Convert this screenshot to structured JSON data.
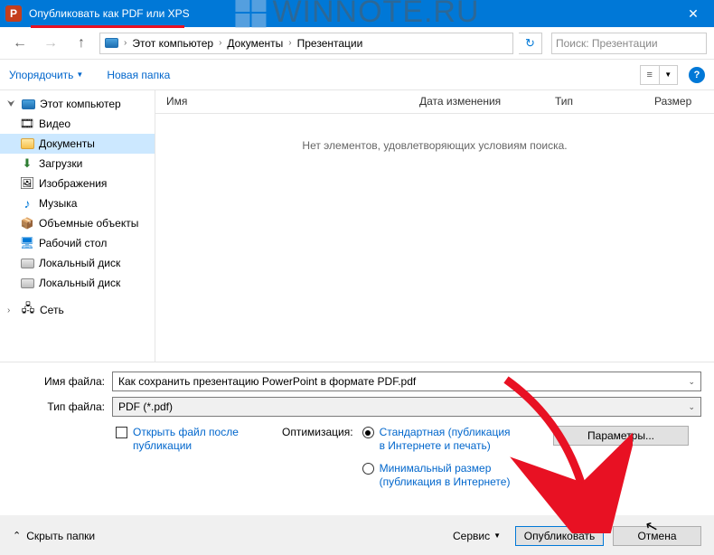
{
  "watermark": {
    "text": "WINNOTE.RU"
  },
  "titlebar": {
    "title": "Опубликовать как PDF или XPS"
  },
  "nav": {
    "breadcrumb": {
      "root": "Этот компьютер",
      "p1": "Документы",
      "p2": "Презентации"
    },
    "search_placeholder": "Поиск: Презентации"
  },
  "toolbar": {
    "organize": "Упорядочить",
    "new_folder": "Новая папка"
  },
  "sidebar": {
    "items": [
      {
        "label": "Этот компьютер"
      },
      {
        "label": "Видео"
      },
      {
        "label": "Документы"
      },
      {
        "label": "Загрузки"
      },
      {
        "label": "Изображения"
      },
      {
        "label": "Музыка"
      },
      {
        "label": "Объемные объекты"
      },
      {
        "label": "Рабочий стол"
      },
      {
        "label": "Локальный диск"
      },
      {
        "label": "Локальный диск"
      },
      {
        "label": "Сеть"
      }
    ]
  },
  "list": {
    "headers": {
      "name": "Имя",
      "date": "Дата изменения",
      "type": "Тип",
      "size": "Размер"
    },
    "empty": "Нет элементов, удовлетворяющих условиям поиска."
  },
  "form": {
    "filename_label": "Имя файла:",
    "filename": "Как сохранить презентацию PowerPoint в формате PDF.pdf",
    "filetype_label": "Тип файла:",
    "filetype": "PDF (*.pdf)",
    "open_after": "Открыть файл после публикации",
    "optimization": "Оптимизация:",
    "opt_standard": "Стандартная (публикация в Интернете и печать)",
    "opt_minimum": "Минимальный размер (публикация в Интернете)",
    "parameters": "Параметры..."
  },
  "footer": {
    "hide_folders": "Скрыть папки",
    "tools": "Сервис",
    "publish": "Опубликовать",
    "cancel": "Отмена"
  }
}
